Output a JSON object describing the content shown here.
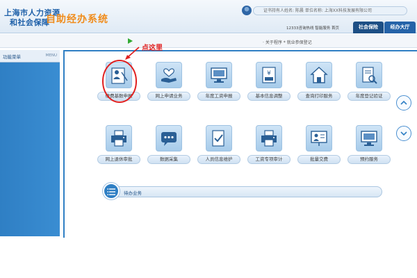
{
  "header": {
    "logo_line1": "上海市人力资源",
    "logo_line2": "和社会保障",
    "system_name": "自助经办系统",
    "user_bar_text": "证书持有人姓名: 陈晨    单位名称: 上海XX科技发展有限公司",
    "hotline": "12333咨询热线  智能服务  首页",
    "tab_public": "社会保险",
    "tab_progress": "经办大厅"
  },
  "subbar": {
    "notice": "· 关于程序 * 就业参保登记"
  },
  "annotation": {
    "label": "点这里",
    "color": "#e02020"
  },
  "sidebar": {
    "title": "功能菜单",
    "menu": "MENU"
  },
  "services": [
    {
      "label": "缴费基数申报",
      "icon": "person-document-icon"
    },
    {
      "label": "网上申请业务",
      "icon": "hand-heart-icon"
    },
    {
      "label": "年度工资申报",
      "icon": "monitor-icon"
    },
    {
      "label": "基本信息调整",
      "icon": "yen-book-icon"
    },
    {
      "label": "查询打印服务",
      "icon": "house-icon"
    },
    {
      "label": "年度登记验证",
      "icon": "document-search-icon"
    },
    {
      "label": "网上退休审批",
      "icon": "printer-icon"
    },
    {
      "label": "数据采集",
      "icon": "chat-bubble-icon"
    },
    {
      "label": "人员信息维护",
      "icon": "edit-document-icon"
    },
    {
      "label": "工资专项审计",
      "icon": "printer-icon"
    },
    {
      "label": "批量交费",
      "icon": "presentation-icon"
    },
    {
      "label": "预约服务",
      "icon": "monitor-icon"
    }
  ],
  "pending": {
    "label": "待办业务"
  },
  "colors": {
    "accent": "#2f7fc4",
    "brand_orange": "#f08c1c",
    "annotation_red": "#e02020"
  }
}
